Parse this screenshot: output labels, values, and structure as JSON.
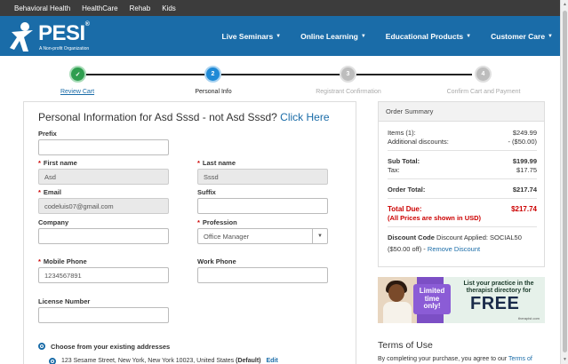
{
  "topbar": {
    "items": [
      "Behavioral Health",
      "HealthCare",
      "Rehab",
      "Kids"
    ]
  },
  "logo": {
    "text": "PESI",
    "reg": "®",
    "sub": "A Non-profit Organization"
  },
  "nav": {
    "items": [
      "Live Seminars",
      "Online Learning",
      "Educational Products",
      "Customer Care"
    ]
  },
  "steps": [
    {
      "num": "✓",
      "label": "Review Cart",
      "state": "done"
    },
    {
      "num": "2",
      "label": "Personal Info",
      "state": "active"
    },
    {
      "num": "3",
      "label": "Registrant Confirmation",
      "state": "pending"
    },
    {
      "num": "4",
      "label": "Confirm Cart and Payment",
      "state": "pending"
    }
  ],
  "colors": {
    "done": "#2e9e4f",
    "active": "#1f8ad6",
    "pending": "#bdbdbd",
    "brand": "#1a6ca8"
  },
  "form": {
    "title": "Personal Information for Asd Sssd - not Asd Sssd?",
    "title_link": "Click Here",
    "prefix_label": "Prefix",
    "prefix_value": "",
    "first_name_label": "First name",
    "first_name_value": "Asd",
    "last_name_label": "Last name",
    "last_name_value": "Sssd",
    "email_label": "Email",
    "email_value": "codeluis07@gmail.com",
    "suffix_label": "Suffix",
    "suffix_value": "",
    "company_label": "Company",
    "company_value": "",
    "profession_label": "Profession",
    "profession_value": "Office Manager",
    "mobile_label": "Mobile Phone",
    "mobile_value": "1234567891",
    "work_phone_label": "Work Phone",
    "work_phone_value": "",
    "license_label": "License Number",
    "license_value": "",
    "address_choice_label": "Choose from your existing addresses",
    "address_text": "123 Sesame Street, New York, New York 10023, United States",
    "address_default": "(Default)",
    "address_edit": "Edit"
  },
  "summary": {
    "title": "Order Summary",
    "items_label": "Items (1):",
    "items_value": "$249.99",
    "discounts_label": "Additional discounts:",
    "discounts_value": "- ($50.00)",
    "subtotal_label": "Sub Total:",
    "subtotal_value": "$199.99",
    "tax_label": "Tax:",
    "tax_value": "$17.75",
    "order_total_label": "Order Total:",
    "order_total_value": "$217.74",
    "total_due_label": "Total Due:",
    "total_due_value": "$217.74",
    "usd_note": "(All Prices are shown in USD)",
    "discount_code_label": "Discount Code",
    "discount_applied": "Discount Applied: SOCIAL50",
    "discount_off": "($50.00 off) -",
    "remove_discount": "Remove Discount"
  },
  "ad": {
    "banner_line1": "Limited",
    "banner_line2": "time",
    "banner_line3": "only!",
    "headline_line1": "List your practice in the",
    "headline_line2": "therapist directory for",
    "free": "FREE",
    "brand": "therapist.com"
  },
  "terms": {
    "title": "Terms of Use",
    "text": "By completing your purchase, you agree to our",
    "link": "Terms of"
  }
}
